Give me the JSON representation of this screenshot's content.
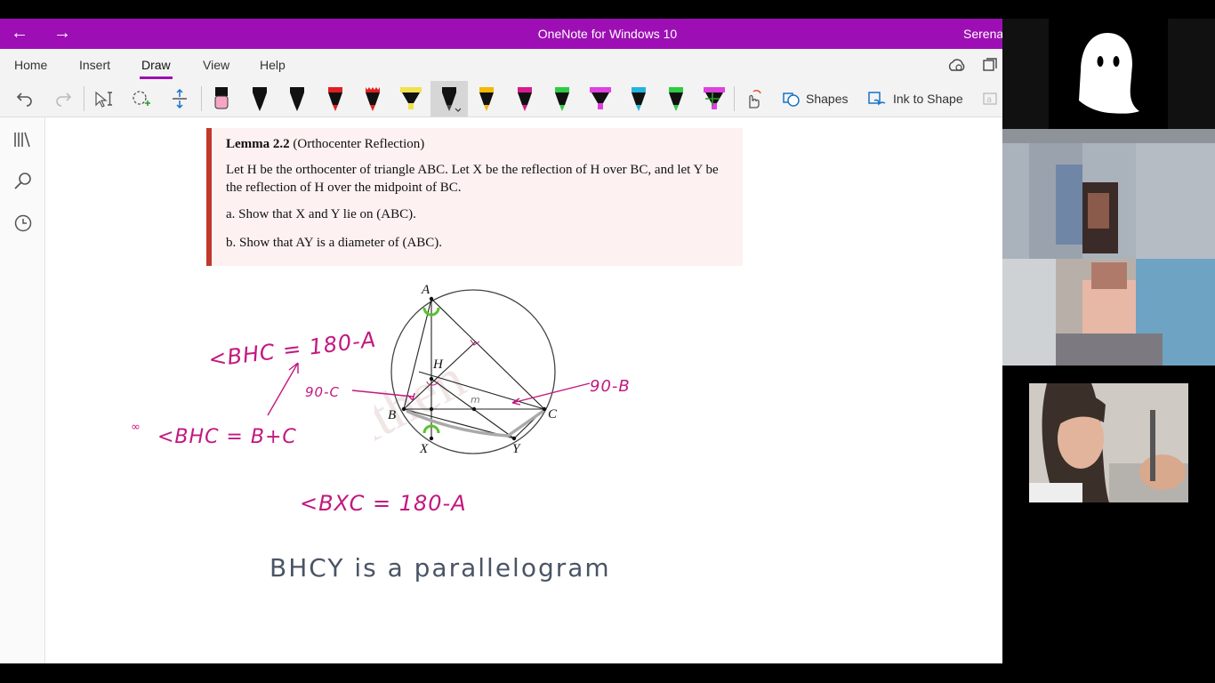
{
  "window": {
    "title": "OneNote for Windows 10",
    "user": "Serena"
  },
  "nav": {
    "back": "←",
    "forward": "→"
  },
  "tabs": [
    "Home",
    "Insert",
    "Draw",
    "View",
    "Help"
  ],
  "toolbar": {
    "shapes_label": "Shapes",
    "ink_to_shape_label": "Ink to Shape"
  },
  "pens": [
    {
      "color": "#f4a6c4",
      "kind": "eraser"
    },
    {
      "color": "#111111",
      "kind": "pen"
    },
    {
      "color": "#111111",
      "kind": "pen"
    },
    {
      "color": "#e02020",
      "kind": "pen"
    },
    {
      "color": "#e02020",
      "kind": "marker"
    },
    {
      "color": "#f0e24a",
      "kind": "highlighter"
    },
    {
      "color": "#444444",
      "kind": "pencil-selected"
    },
    {
      "color": "#f5b800",
      "kind": "pen"
    },
    {
      "color": "#d81b8c",
      "kind": "pen"
    },
    {
      "color": "#2ecc40",
      "kind": "pen"
    },
    {
      "color": "#e040e0",
      "kind": "highlighter"
    },
    {
      "color": "#22b3e0",
      "kind": "pen"
    },
    {
      "color": "#2ecc40",
      "kind": "pen"
    },
    {
      "color": "#e040e0",
      "kind": "highlighter"
    }
  ],
  "lemma": {
    "number": "Lemma 2.2",
    "title": "(Orthocenter Reflection)",
    "body": "Let H be the orthocenter of triangle ABC. Let X be the reflection of H over BC, and let Y be the reflection of H over the midpoint of BC.",
    "part_a": "a.  Show that X and Y lie on (ABC).",
    "part_b": "b.  Show that AY is a diameter of (ABC)."
  },
  "diagram_labels": {
    "A": "A",
    "B": "B",
    "C": "C",
    "H": "H",
    "X": "X",
    "Y": "Y",
    "watermark": "Athen"
  },
  "handwriting": {
    "bhc1": "<BHC = 180-A",
    "ninety_c": "90-C",
    "ninety_b": "90-B",
    "bhc2": "<BHC = B+C",
    "so": "∞",
    "bxc": "<BXC = 180-A",
    "parallelogram": "BHCY is a parallelogram",
    "m": "m"
  }
}
